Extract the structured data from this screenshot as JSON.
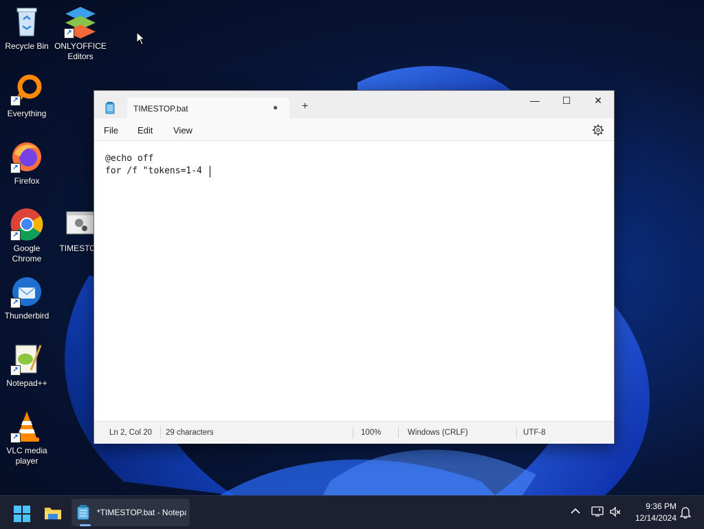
{
  "desktop": {
    "icons": [
      {
        "label": "Recycle Bin",
        "icon": "recycle-bin-icon"
      },
      {
        "label": "ONLYOFFICE Editors",
        "icon": "onlyoffice-icon"
      },
      {
        "label": "Everything",
        "icon": "everything-search-icon"
      },
      {
        "label": "Firefox",
        "icon": "firefox-icon"
      },
      {
        "label": "Google Chrome",
        "icon": "chrome-icon"
      },
      {
        "label": "TIMESTOP",
        "icon": "batch-file-icon"
      },
      {
        "label": "Thunderbird",
        "icon": "thunderbird-icon"
      },
      {
        "label": "Notepad++",
        "icon": "notepadplusplus-icon"
      },
      {
        "label": "VLC media player",
        "icon": "vlc-icon"
      }
    ]
  },
  "notepad": {
    "tab_title": "TIMESTOP.bat",
    "unsaved_marker": "●",
    "new_tab": "+",
    "window_buttons": {
      "minimize": "—",
      "maximize": "☐",
      "close": "✕"
    },
    "menu": [
      "File",
      "Edit",
      "View"
    ],
    "content_lines": [
      "@echo off",
      "for /f \"tokens=1-4 "
    ],
    "status": {
      "position": "Ln 2, Col 20",
      "characters": "29 characters",
      "zoom": "100%",
      "line_ending": "Windows (CRLF)",
      "encoding": "UTF-8"
    }
  },
  "taskbar": {
    "notepad_task_label": "*TIMESTOP.bat - Notepad",
    "time": "9:36 PM",
    "date": "12/14/2024"
  },
  "colors": {
    "accent": "#0078d4",
    "desktop_bg": "#071434",
    "taskbar_bg": "#1c2030"
  }
}
